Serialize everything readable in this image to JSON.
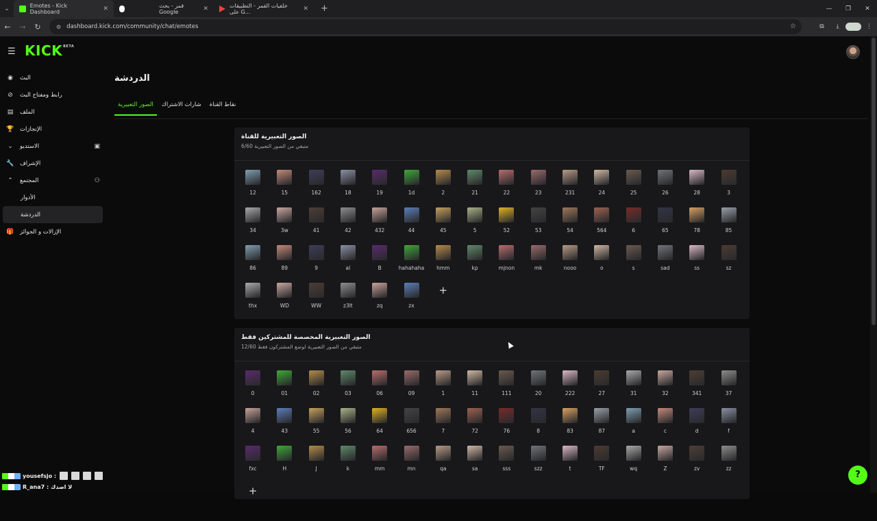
{
  "browser": {
    "tabs": [
      {
        "title": "Emotes - Kick Dashboard",
        "favicon": "kick-logo-icon",
        "active": true,
        "color": "#53fc18"
      },
      {
        "title": "قمر - بحث Google",
        "favicon": "google-icon",
        "active": false,
        "color": "#ffffff"
      },
      {
        "title": "خلفيات القمر - التطبيقات على G...",
        "favicon": "play-store-icon",
        "active": false,
        "color": "#4b8cf5"
      }
    ],
    "url": "dashboard.kick.com/community/chat/emotes"
  },
  "app": {
    "logo": "KICK",
    "logo_badge": "BETA",
    "accent": "#53fc18"
  },
  "sidebar": {
    "items": [
      {
        "label": "البث",
        "icon": "live-broadcast-icon",
        "right_icon": ""
      },
      {
        "label": "رابط ومفتاح البث",
        "icon": "link-icon",
        "right_icon": ""
      },
      {
        "label": "الملف",
        "icon": "profile-card-icon",
        "right_icon": ""
      },
      {
        "label": "الإنجازات",
        "icon": "trophy-icon",
        "right_icon": ""
      },
      {
        "label": "الاستديو",
        "icon": "chevron-down-icon",
        "right_icon": "screen-share-icon"
      },
      {
        "label": "الإشراف",
        "icon": "wrench-icon",
        "right_icon": ""
      },
      {
        "label": "المجتمع",
        "icon": "chevron-up-icon",
        "right_icon": "add-user-icon"
      },
      {
        "label": "الأدوار",
        "icon": "",
        "right_icon": "",
        "sub": true
      },
      {
        "label": "الدردشة",
        "icon": "",
        "right_icon": "",
        "sub": true,
        "selected": true
      },
      {
        "label": "الإزالات و الجوائز",
        "icon": "gift-icon",
        "right_icon": ""
      }
    ]
  },
  "page": {
    "title": "الدردشة",
    "tabs": [
      {
        "label": "الصور التعبيرية",
        "active": true
      },
      {
        "label": "شارات الاشتراك",
        "active": false
      },
      {
        "label": "نقاط القناة",
        "active": false
      }
    ]
  },
  "channel_emotes": {
    "title": "الصور التعبيرية للقناة",
    "subtitle": "6/60 متبقي من الصور التعبيرية",
    "names": [
      "12",
      "15",
      "162",
      "18",
      "19",
      "1d",
      "2",
      "21",
      "22",
      "23",
      "231",
      "24",
      "25",
      "26",
      "28",
      "3",
      "34",
      "3w",
      "41",
      "42",
      "432",
      "44",
      "45",
      "5",
      "52",
      "53",
      "54",
      "564",
      "6",
      "65",
      "78",
      "85",
      "86",
      "89",
      "9",
      "al",
      "B",
      "hahahaha",
      "hmm",
      "kp",
      "mjnon",
      "mk",
      "nooo",
      "o",
      "s",
      "sad",
      "ss",
      "sz",
      "thx",
      "WD",
      "WW",
      "z3lt",
      "zq",
      "zx"
    ],
    "add_label": "+"
  },
  "subscriber_emotes": {
    "title": "الصور التعبيرية المخصصة للمشتركين فقط",
    "subtitle": "12/60 متبقي من الصور التعبيرية لوضع المشتركون فقط",
    "names": [
      "0",
      "01",
      "02",
      "03",
      "06",
      "09",
      "1",
      "11",
      "111",
      "20",
      "222",
      "27",
      "31",
      "32",
      "341",
      "37",
      "4",
      "43",
      "55",
      "56",
      "64",
      "656",
      "7",
      "72",
      "76",
      "8",
      "83",
      "87",
      "a",
      "c",
      "d",
      "f",
      "fxc",
      "H",
      "J",
      "k",
      "mm",
      "mn",
      "qa",
      "sa",
      "sss",
      "szz",
      "t",
      "TF",
      "wq",
      "Z",
      "zv",
      "zz"
    ],
    "add_label": "+"
  },
  "chat_overlay": [
    {
      "user": "yousefsjo :",
      "emote_count": 4
    },
    {
      "user": "R_ana7 : لا اصدك",
      "emote_count": 0
    }
  ]
}
